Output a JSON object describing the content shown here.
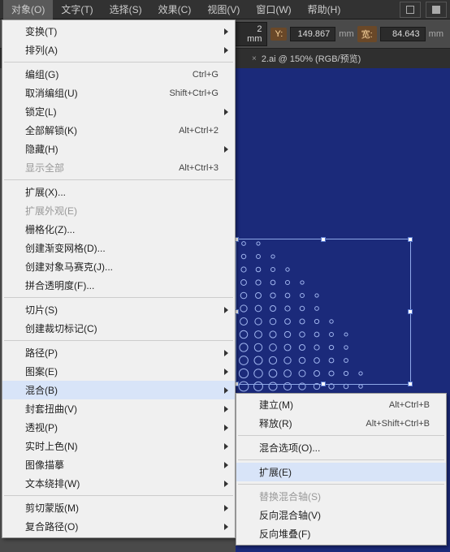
{
  "menubar": {
    "items": [
      {
        "label": "对象(O)"
      },
      {
        "label": "文字(T)"
      },
      {
        "label": "选择(S)"
      },
      {
        "label": "效果(C)"
      },
      {
        "label": "视图(V)"
      },
      {
        "label": "窗口(W)"
      },
      {
        "label": "帮助(H)"
      }
    ]
  },
  "controlbar": {
    "x_suffix": "2 mm",
    "y_label": "Y:",
    "y_value": "149.867",
    "y_unit": "mm",
    "w_label": "宽:",
    "w_value": "84.643",
    "w_unit": "mm"
  },
  "tab": {
    "close": "×",
    "title": "2.ai @ 150% (RGB/预览)"
  },
  "mainMenu": [
    {
      "t": "sub",
      "label": "变换(T)"
    },
    {
      "t": "sub",
      "label": "排列(A)"
    },
    {
      "t": "sep"
    },
    {
      "t": "item",
      "label": "编组(G)",
      "shortcut": "Ctrl+G"
    },
    {
      "t": "item",
      "label": "取消编组(U)",
      "shortcut": "Shift+Ctrl+G"
    },
    {
      "t": "sub",
      "label": "锁定(L)"
    },
    {
      "t": "item",
      "label": "全部解锁(K)",
      "shortcut": "Alt+Ctrl+2"
    },
    {
      "t": "sub",
      "label": "隐藏(H)"
    },
    {
      "t": "item",
      "label": "显示全部",
      "shortcut": "Alt+Ctrl+3",
      "disabled": true
    },
    {
      "t": "sep"
    },
    {
      "t": "item",
      "label": "扩展(X)..."
    },
    {
      "t": "item",
      "label": "扩展外观(E)",
      "disabled": true
    },
    {
      "t": "item",
      "label": "栅格化(Z)..."
    },
    {
      "t": "item",
      "label": "创建渐变网格(D)..."
    },
    {
      "t": "item",
      "label": "创建对象马赛克(J)..."
    },
    {
      "t": "item",
      "label": "拼合透明度(F)..."
    },
    {
      "t": "sep"
    },
    {
      "t": "sub",
      "label": "切片(S)"
    },
    {
      "t": "item",
      "label": "创建裁切标记(C)"
    },
    {
      "t": "sep"
    },
    {
      "t": "sub",
      "label": "路径(P)"
    },
    {
      "t": "sub",
      "label": "图案(E)"
    },
    {
      "t": "sub",
      "label": "混合(B)",
      "hl": true
    },
    {
      "t": "sub",
      "label": "封套扭曲(V)"
    },
    {
      "t": "sub",
      "label": "透视(P)"
    },
    {
      "t": "sub",
      "label": "实时上色(N)"
    },
    {
      "t": "sub",
      "label": "图像描摹"
    },
    {
      "t": "sub",
      "label": "文本绕排(W)"
    },
    {
      "t": "sep"
    },
    {
      "t": "sub",
      "label": "剪切蒙版(M)"
    },
    {
      "t": "sub",
      "label": "复合路径(O)"
    }
  ],
  "subMenu": [
    {
      "t": "item",
      "label": "建立(M)",
      "shortcut": "Alt+Ctrl+B"
    },
    {
      "t": "item",
      "label": "释放(R)",
      "shortcut": "Alt+Shift+Ctrl+B"
    },
    {
      "t": "sep"
    },
    {
      "t": "item",
      "label": "混合选项(O)..."
    },
    {
      "t": "sep"
    },
    {
      "t": "item",
      "label": "扩展(E)",
      "hl": true
    },
    {
      "t": "sep"
    },
    {
      "t": "item",
      "label": "替换混合轴(S)",
      "disabled": true
    },
    {
      "t": "item",
      "label": "反向混合轴(V)"
    },
    {
      "t": "item",
      "label": "反向堆叠(F)"
    }
  ],
  "icons": {
    "doc": "doc-icon",
    "grid": "grid-icon",
    "panel": "panel-icon"
  }
}
